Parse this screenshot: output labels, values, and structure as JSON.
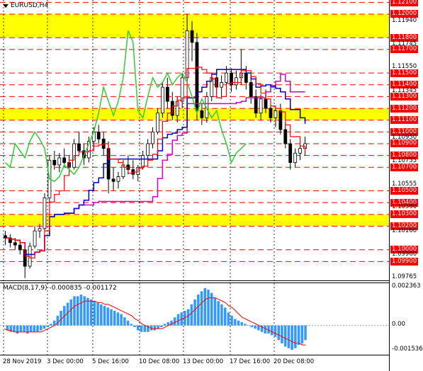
{
  "chart": {
    "symbol": "EURUSD,H4",
    "colors": {
      "zone": "#ffff00",
      "level_line": "#ff0000",
      "candle": "#000000",
      "tenkan": "#ff0000",
      "kijun": "#0000c0",
      "chikou": "#33cc33",
      "senkou_b": "#cc00cc",
      "cloud": "#f4a460",
      "bands": "#66dd66",
      "macd_hist": "#3399ff",
      "macd_signal": "#ff0000"
    }
  },
  "price_axis": {
    "labels": [
      {
        "text": "1.12100",
        "style": "red"
      },
      {
        "text": "1.12000",
        "style": "red"
      },
      {
        "text": "1.11940",
        "style": "plain"
      },
      {
        "text": "1.11800",
        "style": "red"
      },
      {
        "text": "1.11745",
        "style": "plain"
      },
      {
        "text": "1.11700",
        "style": "red"
      },
      {
        "text": "1.11550",
        "style": "plain"
      },
      {
        "text": "1.11500",
        "style": "red"
      },
      {
        "text": "1.11400",
        "style": "red"
      },
      {
        "text": "1.11345",
        "style": "plain"
      },
      {
        "text": "1.11300",
        "style": "red"
      },
      {
        "text": "1.11200",
        "style": "red"
      },
      {
        "text": "1.11100",
        "style": "red"
      },
      {
        "text": "1.11000",
        "style": "red"
      },
      {
        "text": "1.10950",
        "style": "plain"
      },
      {
        "text": "1.10900",
        "style": "red"
      },
      {
        "text": "1.10800",
        "style": "red"
      },
      {
        "text": "1.10755",
        "style": "plain"
      },
      {
        "text": "1.10700",
        "style": "red"
      },
      {
        "text": "1.10555",
        "style": "plain"
      },
      {
        "text": "1.10500",
        "style": "red"
      },
      {
        "text": "1.10400",
        "style": "red"
      },
      {
        "text": "1.10360",
        "style": "plain"
      },
      {
        "text": "1.10300",
        "style": "red"
      },
      {
        "text": "1.10200",
        "style": "red"
      },
      {
        "text": "1.10160",
        "style": "plain"
      },
      {
        "text": "1.10000",
        "style": "red"
      },
      {
        "text": "1.09960",
        "style": "plain"
      },
      {
        "text": "1.09900",
        "style": "red"
      },
      {
        "text": "1.09765",
        "style": "plain"
      }
    ]
  },
  "macd": {
    "title": "MACD(8,17,9) -0.000835 -0.001172",
    "axis_labels": [
      "0.002363",
      "0.00",
      "-0.001536"
    ],
    "histogram": [
      0.0,
      -0.0003,
      -0.0004,
      -0.0004,
      -0.0005,
      -0.0004,
      -0.0004,
      -0.0005,
      -0.0004,
      -0.0004,
      -0.0004,
      -0.0003,
      -0.0002,
      -0.0001,
      0.0001,
      0.0003,
      0.0006,
      0.0009,
      0.0012,
      0.0014,
      0.0016,
      0.0018,
      0.0018,
      0.0019,
      0.0018,
      0.0017,
      0.0016,
      0.0015,
      0.0014,
      0.0013,
      0.0012,
      0.0011,
      0.001,
      0.0009,
      0.0008,
      0.0007,
      0.0005,
      0.0003,
      0.0001,
      -0.0001,
      -0.0003,
      -0.0004,
      -0.0004,
      -0.0004,
      -0.0003,
      -0.0003,
      -0.0002,
      -0.0001,
      0.0001,
      0.0002,
      0.0003,
      0.0005,
      0.0007,
      0.0008,
      0.0009,
      0.001,
      0.0013,
      0.0016,
      0.0019,
      0.0021,
      0.0023,
      0.0022,
      0.002,
      0.0017,
      0.0015,
      0.0013,
      0.0011,
      0.0008,
      0.0006,
      0.0004,
      0.0003,
      0.0002,
      0.0001,
      0.0,
      -0.0001,
      -0.0002,
      -0.0003,
      -0.0004,
      -0.0005,
      -0.0005,
      -0.0006,
      -0.0007,
      -0.0009,
      -0.0011,
      -0.0013,
      -0.0014,
      -0.0015,
      -0.0014,
      -0.0012,
      -0.0011,
      -0.0009
    ],
    "signal": [
      -0.0002,
      -0.0003,
      -0.0003,
      -0.0004,
      -0.0004,
      -0.0004,
      -0.0004,
      -0.0004,
      -0.0004,
      -0.0004,
      -0.0004,
      -0.0004,
      -0.0003,
      -0.0002,
      -0.0001,
      0.0,
      0.0002,
      0.0004,
      0.0006,
      0.0008,
      0.001,
      0.0012,
      0.0013,
      0.0014,
      0.0015,
      0.0015,
      0.0015,
      0.0015,
      0.0014,
      0.0014,
      0.0013,
      0.0013,
      0.0012,
      0.0011,
      0.001,
      0.0009,
      0.0008,
      0.0007,
      0.0006,
      0.0004,
      0.0003,
      0.0001,
      0.0,
      -0.0001,
      -0.0002,
      -0.0002,
      -0.0002,
      -0.0002,
      -0.0001,
      0.0,
      0.0001,
      0.0002,
      0.0003,
      0.0004,
      0.0005,
      0.0006,
      0.0008,
      0.001,
      0.0012,
      0.0014,
      0.0016,
      0.0017,
      0.0017,
      0.0017,
      0.0016,
      0.0015,
      0.0014,
      0.0012,
      0.0011,
      0.0009,
      0.0007,
      0.0005,
      0.0004,
      0.0003,
      0.0002,
      0.0001,
      0.0,
      -0.0001,
      -0.0002,
      -0.0003,
      -0.0004,
      -0.0005,
      -0.0006,
      -0.0007,
      -0.0008,
      -0.0009,
      -0.001,
      -0.0011,
      -0.0011,
      -0.0012,
      -0.0012
    ]
  },
  "time_axis": {
    "labels": [
      "28 Nov 2019",
      "3 Dec 00:00",
      "5 Dec 16:00",
      "10 Dec 08:00",
      "13 Dec 00:00",
      "17 Dec 16:00",
      "20 Dec 08:00"
    ]
  },
  "price_series": {
    "candles": [
      [
        1.1012,
        1.1016,
        1.1004,
        1.101
      ],
      [
        1.101,
        1.1013,
        1.1002,
        1.1006
      ],
      [
        1.1006,
        1.101,
        1.1,
        1.1004
      ],
      [
        1.1004,
        1.1008,
        1.0996,
        1.1
      ],
      [
        1.1,
        1.1005,
        1.0976,
        1.0986
      ],
      [
        1.0986,
        1.1006,
        1.0984,
        1.1003
      ],
      [
        1.1003,
        1.102,
        1.1001,
        1.1016
      ],
      [
        1.1016,
        1.1022,
        1.101,
        1.1018
      ],
      [
        1.1018,
        1.1048,
        1.1016,
        1.1044
      ],
      [
        1.1044,
        1.108,
        1.104,
        1.1076
      ],
      [
        1.1076,
        1.1084,
        1.1068,
        1.1072
      ],
      [
        1.1072,
        1.1082,
        1.1066,
        1.1078
      ],
      [
        1.1078,
        1.1086,
        1.107,
        1.1074
      ],
      [
        1.1074,
        1.108,
        1.1066,
        1.107
      ],
      [
        1.107,
        1.1094,
        1.1068,
        1.109
      ],
      [
        1.109,
        1.11,
        1.108,
        1.1084
      ],
      [
        1.1084,
        1.109,
        1.1072,
        1.1078
      ],
      [
        1.1078,
        1.1096,
        1.1074,
        1.1092
      ],
      [
        1.1092,
        1.1104,
        1.1086,
        1.11
      ],
      [
        1.11,
        1.1106,
        1.109,
        1.1094
      ],
      [
        1.1094,
        1.11,
        1.108,
        1.1086
      ],
      [
        1.1086,
        1.1092,
        1.1048,
        1.106
      ],
      [
        1.106,
        1.107,
        1.105,
        1.1058
      ],
      [
        1.1058,
        1.1066,
        1.1052,
        1.1062
      ],
      [
        1.1062,
        1.1076,
        1.106,
        1.1072
      ],
      [
        1.1072,
        1.108,
        1.1064,
        1.1068
      ],
      [
        1.1068,
        1.1076,
        1.106,
        1.1064
      ],
      [
        1.1064,
        1.1072,
        1.1058,
        1.107
      ],
      [
        1.107,
        1.1084,
        1.1068,
        1.108
      ],
      [
        1.108,
        1.1094,
        1.1076,
        1.109
      ],
      [
        1.109,
        1.1104,
        1.1086,
        1.11
      ],
      [
        1.11,
        1.112,
        1.1098,
        1.1116
      ],
      [
        1.1116,
        1.1142,
        1.1112,
        1.1138
      ],
      [
        1.1138,
        1.1146,
        1.112,
        1.1126
      ],
      [
        1.1126,
        1.1134,
        1.111,
        1.1114
      ],
      [
        1.1114,
        1.113,
        1.1108,
        1.1126
      ],
      [
        1.1126,
        1.115,
        1.112,
        1.1146
      ],
      [
        1.1146,
        1.12,
        1.114,
        1.1186
      ],
      [
        1.1186,
        1.1194,
        1.116,
        1.1176
      ],
      [
        1.1176,
        1.1184,
        1.111,
        1.1118
      ],
      [
        1.1118,
        1.1124,
        1.1106,
        1.1112
      ],
      [
        1.1112,
        1.1134,
        1.1108,
        1.113
      ],
      [
        1.113,
        1.115,
        1.1126,
        1.1146
      ],
      [
        1.1146,
        1.1152,
        1.1132,
        1.1138
      ],
      [
        1.1138,
        1.1148,
        1.1128,
        1.1142
      ],
      [
        1.1142,
        1.1156,
        1.1136,
        1.115
      ],
      [
        1.115,
        1.1154,
        1.1134,
        1.114
      ],
      [
        1.114,
        1.1152,
        1.1136,
        1.1146
      ],
      [
        1.1146,
        1.117,
        1.114,
        1.115
      ],
      [
        1.115,
        1.1156,
        1.1136,
        1.1142
      ],
      [
        1.1142,
        1.1146,
        1.1124,
        1.113
      ],
      [
        1.113,
        1.1136,
        1.1112,
        1.1116
      ],
      [
        1.1116,
        1.1132,
        1.111,
        1.1128
      ],
      [
        1.1128,
        1.1136,
        1.1116,
        1.112
      ],
      [
        1.112,
        1.1126,
        1.1108,
        1.1112
      ],
      [
        1.1112,
        1.1122,
        1.1104,
        1.1118
      ],
      [
        1.1118,
        1.1124,
        1.1098,
        1.1102
      ],
      [
        1.1102,
        1.1108,
        1.1086,
        1.109
      ],
      [
        1.109,
        1.1094,
        1.1068,
        1.1074
      ],
      [
        1.1074,
        1.1086,
        1.107,
        1.1082
      ],
      [
        1.1082,
        1.1092,
        1.1076,
        1.1086
      ],
      [
        1.1086,
        1.1096,
        1.108,
        1.109
      ]
    ]
  }
}
